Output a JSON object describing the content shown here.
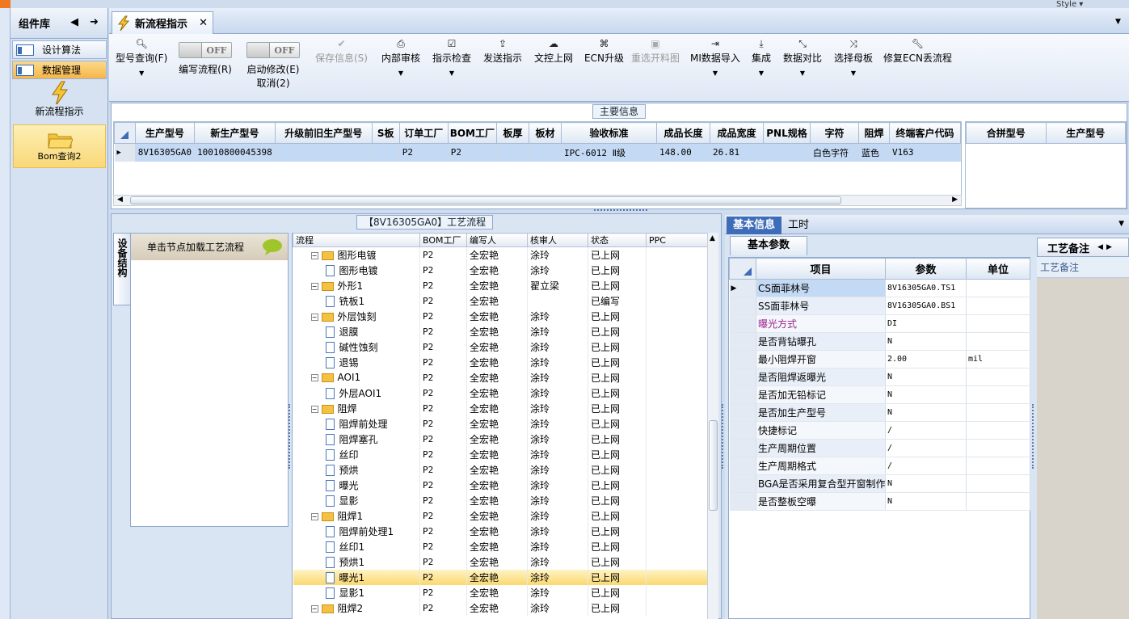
{
  "window": {
    "style_label": "Style"
  },
  "library": {
    "title": "组件库",
    "items": [
      {
        "label": "设计算法"
      },
      {
        "label": "数据管理"
      }
    ],
    "tiles": [
      {
        "label": "新流程指示"
      },
      {
        "label": "Bom查询2"
      }
    ]
  },
  "tab": {
    "label": "新流程指示"
  },
  "toolbar": {
    "items": [
      {
        "label": "型号查询(F)",
        "icon": "search-icon"
      },
      {
        "label": "编写流程(R)",
        "toggle": "OFF"
      },
      {
        "label": "启动修改(E)",
        "label2": "取消(2)",
        "toggle": "OFF"
      },
      {
        "label": "保存信息(S)",
        "icon": "check-icon",
        "disabled": true
      },
      {
        "label": "内部审核",
        "icon": "print-icon"
      },
      {
        "label": "指示检查",
        "icon": "checkbox-icon"
      },
      {
        "label": "发送指示",
        "icon": "upload-icon"
      },
      {
        "label": "文控上网",
        "icon": "cloud-upload-icon"
      },
      {
        "label": "ECN升级",
        "icon": "binoculars-icon"
      },
      {
        "label": "重选开料图",
        "icon": "image-icon",
        "disabled": true
      },
      {
        "label": "MI数据导入",
        "icon": "import-icon"
      },
      {
        "label": "集成",
        "icon": "download-icon"
      },
      {
        "label": "数据对比",
        "icon": "compress-icon"
      },
      {
        "label": "选择母板",
        "icon": "shuffle-icon"
      },
      {
        "label": "修复ECN丢流程",
        "icon": "wrench-icon"
      }
    ]
  },
  "main": {
    "title": "主要信息",
    "columns": [
      "生产型号",
      "新生产型号",
      "升级前旧生产型号",
      "S板",
      "订单工厂",
      "BOM工厂",
      "板厚",
      "板材",
      "验收标准",
      "成品长度",
      "成品宽度",
      "PNL规格",
      "字符",
      "阻焊",
      "终端客户代码"
    ],
    "row": [
      "8V16305GA0",
      "10010800045398",
      "",
      "",
      "P2",
      "P2",
      "",
      "",
      "IPC-6012 Ⅱ级",
      "148.00",
      "26.81",
      "",
      "白色字符",
      "蓝色",
      "V163"
    ],
    "side_columns": [
      "合拼型号",
      "生产型号"
    ]
  },
  "flow": {
    "title": "【8V16305GA0】工艺流程",
    "vtab": "设备结构",
    "load_hint": "单击节点加载工艺流程",
    "columns": [
      "流程",
      "BOM工厂",
      "编写人",
      "核审人",
      "状态",
      "PPC"
    ],
    "rows": [
      {
        "name": "图形电镀",
        "folder": true,
        "bom": "P2",
        "writer": "全宏艳",
        "reviewer": "涂玲",
        "status": "已上网"
      },
      {
        "name": "图形电镀",
        "bom": "P2",
        "writer": "全宏艳",
        "reviewer": "涂玲",
        "status": "已上网"
      },
      {
        "name": "外形1",
        "folder": true,
        "bom": "P2",
        "writer": "全宏艳",
        "reviewer": "翟立梁",
        "status": "已上网"
      },
      {
        "name": "铣板1",
        "bom": "P2",
        "writer": "全宏艳",
        "reviewer": "",
        "status": "已编写"
      },
      {
        "name": "外层蚀刻",
        "folder": true,
        "bom": "P2",
        "writer": "全宏艳",
        "reviewer": "涂玲",
        "status": "已上网"
      },
      {
        "name": "退膜",
        "bom": "P2",
        "writer": "全宏艳",
        "reviewer": "涂玲",
        "status": "已上网"
      },
      {
        "name": "碱性蚀刻",
        "bom": "P2",
        "writer": "全宏艳",
        "reviewer": "涂玲",
        "status": "已上网"
      },
      {
        "name": "退锡",
        "bom": "P2",
        "writer": "全宏艳",
        "reviewer": "涂玲",
        "status": "已上网"
      },
      {
        "name": "AOI1",
        "folder": true,
        "bom": "P2",
        "writer": "全宏艳",
        "reviewer": "涂玲",
        "status": "已上网"
      },
      {
        "name": "外层AOI1",
        "bom": "P2",
        "writer": "全宏艳",
        "reviewer": "涂玲",
        "status": "已上网"
      },
      {
        "name": "阻焊",
        "folder": true,
        "bom": "P2",
        "writer": "全宏艳",
        "reviewer": "涂玲",
        "status": "已上网"
      },
      {
        "name": "阻焊前处理",
        "bom": "P2",
        "writer": "全宏艳",
        "reviewer": "涂玲",
        "status": "已上网"
      },
      {
        "name": "阻焊塞孔",
        "bom": "P2",
        "writer": "全宏艳",
        "reviewer": "涂玲",
        "status": "已上网"
      },
      {
        "name": "丝印",
        "bom": "P2",
        "writer": "全宏艳",
        "reviewer": "涂玲",
        "status": "已上网"
      },
      {
        "name": "预烘",
        "bom": "P2",
        "writer": "全宏艳",
        "reviewer": "涂玲",
        "status": "已上网"
      },
      {
        "name": "曝光",
        "bom": "P2",
        "writer": "全宏艳",
        "reviewer": "涂玲",
        "status": "已上网"
      },
      {
        "name": "显影",
        "bom": "P2",
        "writer": "全宏艳",
        "reviewer": "涂玲",
        "status": "已上网"
      },
      {
        "name": "阻焊1",
        "folder": true,
        "bom": "P2",
        "writer": "全宏艳",
        "reviewer": "涂玲",
        "status": "已上网"
      },
      {
        "name": "阻焊前处理1",
        "bom": "P2",
        "writer": "全宏艳",
        "reviewer": "涂玲",
        "status": "已上网"
      },
      {
        "name": "丝印1",
        "bom": "P2",
        "writer": "全宏艳",
        "reviewer": "涂玲",
        "status": "已上网"
      },
      {
        "name": "预烘1",
        "bom": "P2",
        "writer": "全宏艳",
        "reviewer": "涂玲",
        "status": "已上网"
      },
      {
        "name": "曝光1",
        "bom": "P2",
        "writer": "全宏艳",
        "reviewer": "涂玲",
        "status": "已上网",
        "selected": true
      },
      {
        "name": "显影1",
        "bom": "P2",
        "writer": "全宏艳",
        "reviewer": "涂玲",
        "status": "已上网"
      },
      {
        "name": "阻焊2",
        "folder": true,
        "bom": "P2",
        "writer": "全宏艳",
        "reviewer": "涂玲",
        "status": "已上网"
      }
    ]
  },
  "right": {
    "tabs": [
      "基本信息",
      "工时"
    ],
    "subtab": "基本参数",
    "columns": [
      "项目",
      "参数",
      "单位"
    ],
    "params": [
      {
        "item": "CS面菲林号",
        "value": "8V16305GA0.TS1",
        "unit": ""
      },
      {
        "item": "SS面菲林号",
        "value": "8V16305GA0.BS1",
        "unit": ""
      },
      {
        "item": "曝光方式",
        "value": "DI",
        "unit": "",
        "accent": true
      },
      {
        "item": "是否背钻曝孔",
        "value": "N",
        "unit": ""
      },
      {
        "item": "最小阻焊开窗",
        "value": "2.00",
        "unit": "mil"
      },
      {
        "item": "是否阻焊返曝光",
        "value": "N",
        "unit": ""
      },
      {
        "item": "是否加无铅标记",
        "value": "N",
        "unit": ""
      },
      {
        "item": "是否加生产型号",
        "value": "N",
        "unit": ""
      },
      {
        "item": "快捷标记",
        "value": "/",
        "unit": ""
      },
      {
        "item": "生产周期位置",
        "value": "/",
        "unit": ""
      },
      {
        "item": "生产周期格式",
        "value": "/",
        "unit": ""
      },
      {
        "item": "BGA是否采用复合型开窗制作",
        "value": "N",
        "unit": ""
      },
      {
        "item": "是否整板空曝",
        "value": "N",
        "unit": ""
      }
    ],
    "note_tab": "工艺备注",
    "note_label": "工艺备注"
  },
  "colors": {
    "accent_orange": "#f6b54a",
    "accent_purple": "#a0208f",
    "header_blue": "#3e6cb8"
  }
}
